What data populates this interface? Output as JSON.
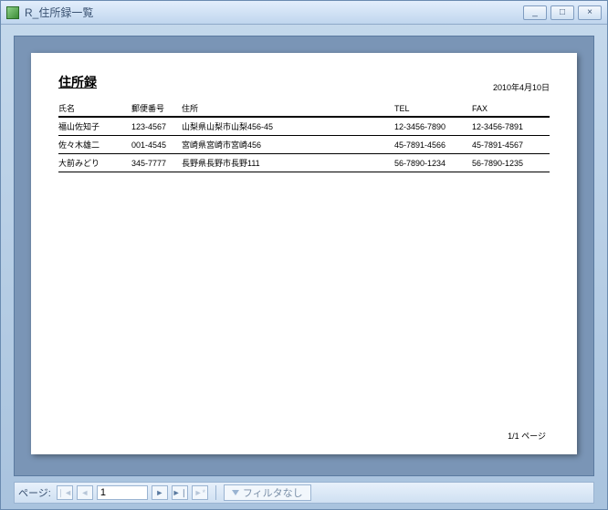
{
  "window": {
    "title": "R_住所録一覧",
    "minimize_glyph": "_",
    "maximize_glyph": "□",
    "close_glyph": "×"
  },
  "report": {
    "title": "住所録",
    "date": "2010年4月10日",
    "columns": {
      "name": "氏名",
      "postal": "郵便番号",
      "address": "住所",
      "tel": "TEL",
      "fax": "FAX"
    },
    "rows": [
      {
        "name": "福山佐知子",
        "postal": "123-4567",
        "address": "山梨県山梨市山梨456-45",
        "tel": "12-3456-7890",
        "fax": "12-3456-7891"
      },
      {
        "name": "佐々木雄二",
        "postal": "001-4545",
        "address": "宮崎県宮崎市宮崎456",
        "tel": "45-7891-4566",
        "fax": "45-7891-4567"
      },
      {
        "name": "大前みどり",
        "postal": "345-7777",
        "address": "長野県長野市長野111",
        "tel": "56-7890-1234",
        "fax": "56-7890-1235"
      }
    ],
    "footer": "1/1 ページ"
  },
  "nav": {
    "label": "ページ:",
    "first": "❘◄",
    "prev": "◄",
    "current": "1",
    "next": "►",
    "last": "►❘",
    "new": "►*",
    "filter": "フィルタなし"
  }
}
